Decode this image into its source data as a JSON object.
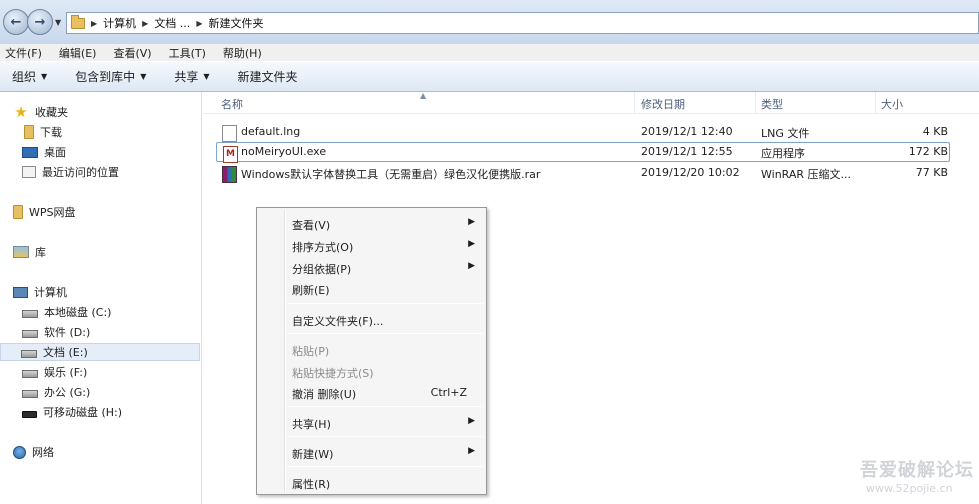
{
  "address_bar": {
    "breadcrumbs": [
      "计算机",
      "文档 ...",
      "新建文件夹"
    ]
  },
  "menubar": {
    "items": [
      "文件(F)",
      "编辑(E)",
      "查看(V)",
      "工具(T)",
      "帮助(H)"
    ]
  },
  "toolbar": {
    "organize": "组织",
    "include_in_library": "包含到库中",
    "share": "共享",
    "new_folder": "新建文件夹"
  },
  "sidebar": {
    "favorites": "收藏夹",
    "downloads": "下载",
    "desktop": "桌面",
    "recent": "最近访问的位置",
    "wps": "WPS网盘",
    "library": "库",
    "computer": "计算机",
    "drives": [
      "本地磁盘 (C:)",
      "软件 (D:)",
      "文档 (E:)",
      "娱乐 (F:)",
      "办公 (G:)",
      "可移动磁盘 (H:)"
    ],
    "network": "网络"
  },
  "file_list": {
    "columns": {
      "name": "名称",
      "date": "修改日期",
      "type": "类型",
      "size": "大小"
    },
    "files": [
      {
        "name": "default.lng",
        "date": "2019/12/1 12:40",
        "type": "LNG 文件",
        "size": "4 KB",
        "icon": "document-icon"
      },
      {
        "name": "noMeiryoUI.exe",
        "date": "2019/12/1 12:55",
        "type": "应用程序",
        "size": "172 KB",
        "icon": "exe-icon"
      },
      {
        "name": "Windows默认字体替换工具（无需重启）绿色汉化便携版.rar",
        "date": "2019/12/20 10:02",
        "type": "WinRAR 压缩文...",
        "size": "77 KB",
        "icon": "rar-archive-icon"
      }
    ]
  },
  "context_menu": {
    "view": "查看(V)",
    "sort_by": "排序方式(O)",
    "group_by": "分组依据(P)",
    "refresh": "刷新(E)",
    "customize_folder": "自定义文件夹(F)...",
    "paste": "粘贴(P)",
    "paste_shortcut": "粘贴快捷方式(S)",
    "undo_delete": "撤消 删除(U)",
    "undo_shortcut": "Ctrl+Z",
    "share": "共享(H)",
    "new": "新建(W)",
    "properties": "属性(R)"
  },
  "watermark": {
    "title": "吾爱破解论坛",
    "url": "www.52pojie.cn"
  }
}
